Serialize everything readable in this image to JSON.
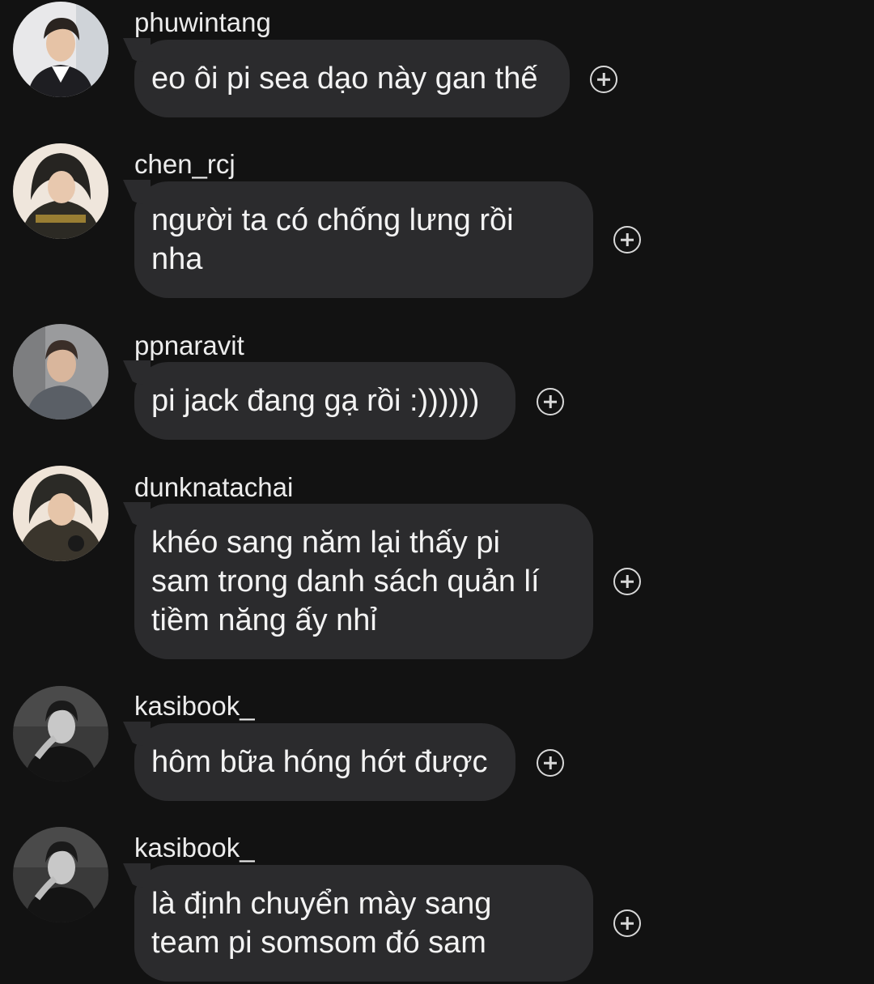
{
  "messages": [
    {
      "username": "phuwintang",
      "text": "eo ôi pi sea dạo này gan thế",
      "avatar": "profile-photo-light"
    },
    {
      "username": "chen_rcj",
      "text": "người ta có chống lưng rồi\nnha",
      "avatar": "profile-photo-hood"
    },
    {
      "username": "ppnaravit",
      "text": "pi jack đang gạ rồi :))))))",
      "avatar": "profile-photo-grey"
    },
    {
      "username": "dunknatachai",
      "text": "khéo sang năm lại thấy pi\nsam trong danh sách quản lí\ntiềm năng ấy nhỉ",
      "avatar": "profile-photo-hood"
    },
    {
      "username": "kasibook_",
      "text": "hôm bữa hóng hớt được",
      "avatar": "profile-photo-bw"
    },
    {
      "username": "kasibook_",
      "text": "là định chuyển mày sang\nteam pi somsom đó sam",
      "avatar": "profile-photo-bw"
    }
  ],
  "icons": {
    "reaction": "add-reaction-icon"
  },
  "colors": {
    "background": "#121212",
    "bubble": "#2b2b2d",
    "text": "#f3f3f3"
  }
}
